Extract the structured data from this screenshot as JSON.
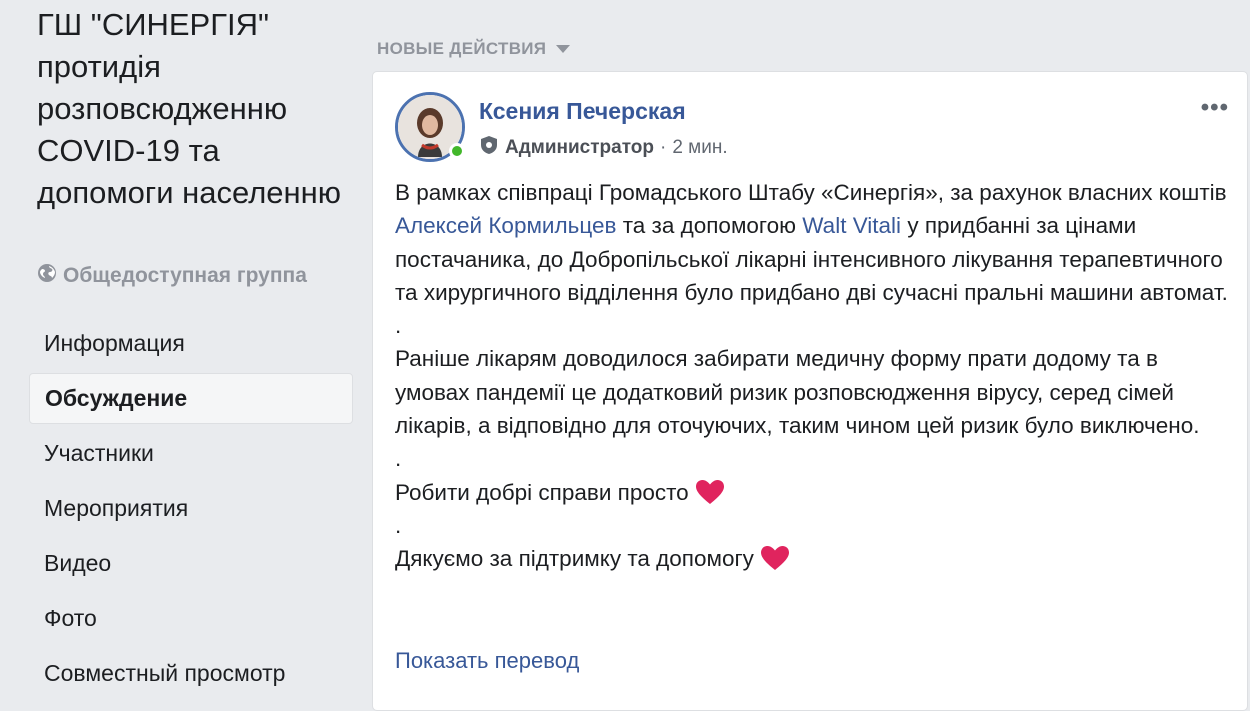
{
  "group": {
    "title": "ГШ \"СИНЕРГІЯ\" протидія розповсюдженню COVID-19 та допомоги населенню",
    "privacy_label": "Общедоступная группа",
    "privacy_icon": "globe-icon"
  },
  "nav": {
    "items": [
      {
        "label": "Информация",
        "active": false
      },
      {
        "label": "Обсуждение",
        "active": true
      },
      {
        "label": "Участники",
        "active": false
      },
      {
        "label": "Мероприятия",
        "active": false
      },
      {
        "label": "Видео",
        "active": false
      },
      {
        "label": "Фото",
        "active": false
      },
      {
        "label": "Совместный просмотр",
        "active": false
      }
    ]
  },
  "feed": {
    "section_label": "НОВЫЕ ДЕЙСТВИЯ",
    "section_icon": "caret-down-icon"
  },
  "post": {
    "author": "Ксения Печерская",
    "role": "Администратор",
    "role_icon": "admin-shield-icon",
    "time": "2 мин.",
    "more_label": "•••",
    "online_color": "#42b72a",
    "p1_a": "В рамках співпраці Громадського Штабу «Синергія», за рахунок власних коштів ",
    "mention1": "Алексей Кормильцев",
    "p1_b": " та за допомогою ",
    "mention2": "Walt Vitali",
    "p1_c": " у придбанні за цінами постачаника, до Добропільської лікарні інтенсивного лікування терапевтичного та хирургичного відділення було придбано дві сучасні пральні машини автомат.",
    "sep1": ".",
    "p2": "Раніше лікарям доводилося забирати медичну форму прати додому та в умовах пандемії це додатковий ризик розповсюдження вірусу, серед сімей лікарів, а відповідно для оточуючих, таким чином цей ризик було виключено.",
    "sep2": ".",
    "p3": "Робити добрі справи просто",
    "sep3": ".",
    "p4": "Дякуємо за підтримку та допомогу",
    "emoji": "heart-emoji-icon",
    "translate_label": "Показать перевод"
  },
  "colors": {
    "link": "#385898",
    "muted": "#90949c",
    "heart": "#e0245e"
  }
}
